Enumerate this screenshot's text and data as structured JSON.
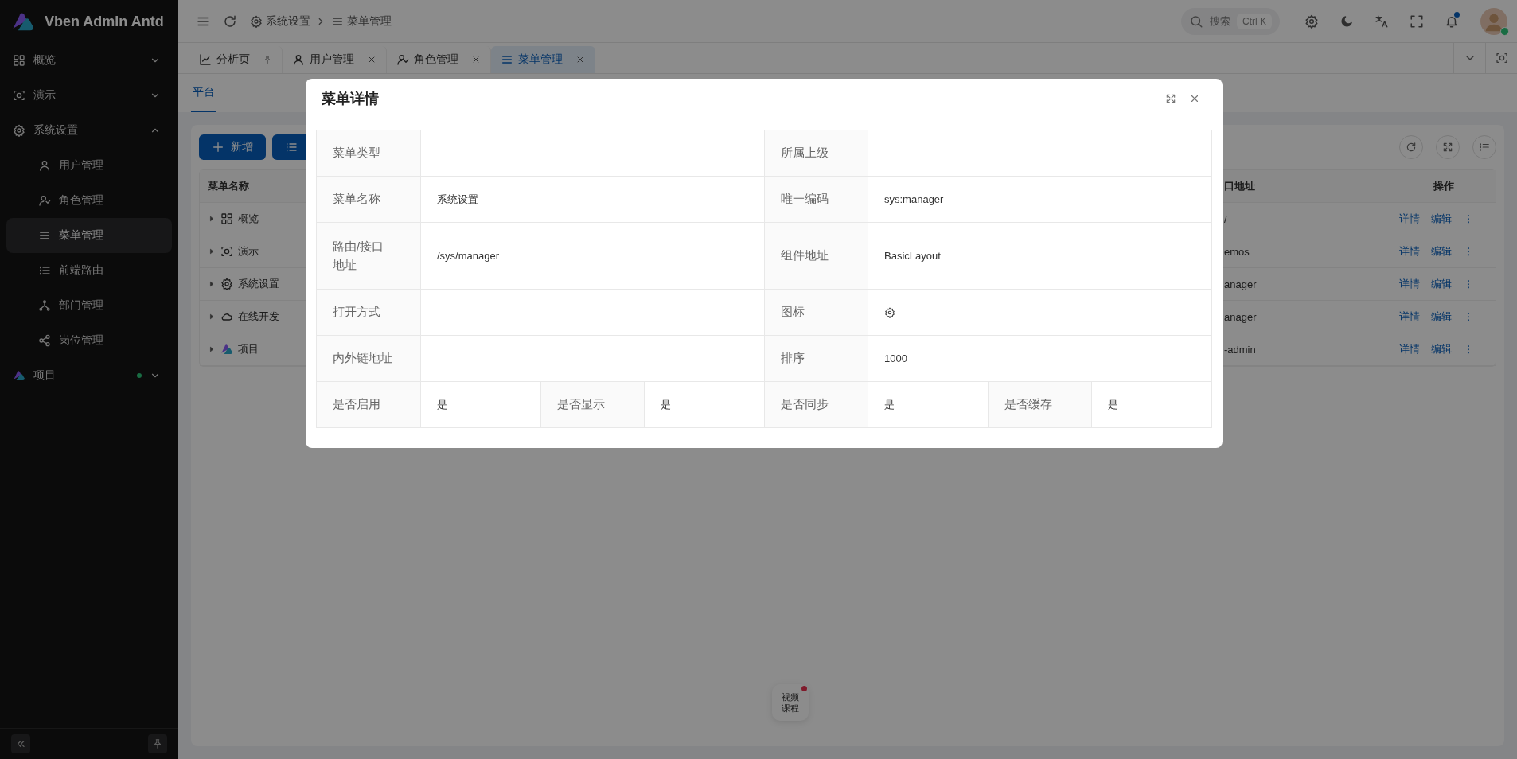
{
  "sidebar": {
    "logo_text": "Vben Admin Antd",
    "items": [
      {
        "label": "概览",
        "expanded": false,
        "dot": false
      },
      {
        "label": "演示",
        "expanded": false,
        "dot": false
      },
      {
        "label": "系统设置",
        "expanded": true,
        "dot": false,
        "children": [
          {
            "label": "用户管理",
            "selected": false
          },
          {
            "label": "角色管理",
            "selected": false
          },
          {
            "label": "菜单管理",
            "selected": true
          },
          {
            "label": "前端路由",
            "selected": false
          },
          {
            "label": "部门管理",
            "selected": false
          },
          {
            "label": "岗位管理",
            "selected": false
          }
        ]
      },
      {
        "label": "项目",
        "expanded": false,
        "dot": true
      }
    ]
  },
  "header": {
    "breadcrumb": [
      "系统设置",
      "菜单管理"
    ],
    "search": {
      "placeholder": "搜索",
      "shortcut": "Ctrl K"
    },
    "notification_dot": true
  },
  "tabs": [
    {
      "label": "分析页",
      "pinned": true,
      "selected": false
    },
    {
      "label": "用户管理",
      "pinned": false,
      "selected": false
    },
    {
      "label": "角色管理",
      "pinned": false,
      "selected": false
    },
    {
      "label": "菜单管理",
      "pinned": false,
      "selected": true
    }
  ],
  "subtabs": [
    {
      "label": "平台",
      "selected": true
    }
  ],
  "toolbar": {
    "add_button": "新增"
  },
  "table": {
    "columns": [
      "菜单名称",
      "口地址",
      "操作"
    ],
    "rows": [
      {
        "name": "概览",
        "address": "/",
        "expanded": false,
        "actions": [
          "详情",
          "编辑"
        ]
      },
      {
        "name": "演示",
        "address": "emos",
        "expanded": false,
        "actions": [
          "详情",
          "编辑"
        ]
      },
      {
        "name": "系统设置",
        "address": "anager",
        "expanded": false,
        "actions": [
          "详情",
          "编辑"
        ]
      },
      {
        "name": "在线开发",
        "address": "anager",
        "expanded": false,
        "actions": [
          "详情",
          "编辑"
        ]
      },
      {
        "name": "项目",
        "address": "-admin",
        "expanded": false,
        "actions": [
          "详情",
          "编辑"
        ]
      }
    ]
  },
  "float_widget": {
    "label": "视频课程",
    "dot": true
  },
  "modal": {
    "title": "菜单详情",
    "rows": [
      [
        {
          "label": "菜单类型"
        },
        {
          "label": "所属上级"
        }
      ],
      [
        {
          "label": "菜单名称",
          "kind": "text",
          "value": "系统设置"
        },
        {
          "label": "唯一编码",
          "kind": "text",
          "value": "sys:manager"
        }
      ],
      [
        {
          "label": "路由/接口地址",
          "kind": "text",
          "value": "/sys/manager"
        },
        {
          "label": "组件地址",
          "kind": "text",
          "value": "BasicLayout"
        }
      ],
      [
        {
          "label": "打开方式"
        },
        {
          "label": "图标",
          "kind": "icon"
        }
      ],
      [
        {
          "label": "内外链地址"
        },
        {
          "label": "排序",
          "kind": "text",
          "value": "1000"
        }
      ],
      [
        {
          "label": "是否启用",
          "kind": "text",
          "value": "是"
        },
        {
          "label": "是否显示",
          "kind": "text",
          "value": "是"
        },
        {
          "label": "是否同步",
          "kind": "text",
          "value": "是"
        },
        {
          "label": "是否缓存",
          "kind": "text",
          "value": "是"
        }
      ]
    ]
  }
}
